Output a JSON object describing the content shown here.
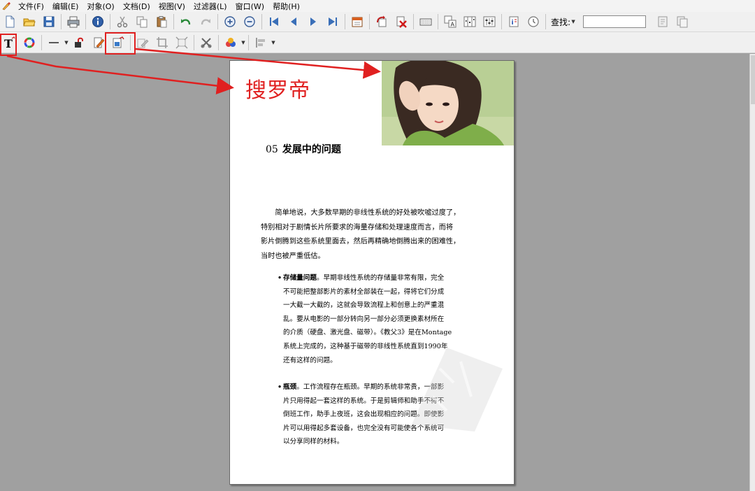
{
  "menubar": {
    "items": [
      "文件(F)",
      "编辑(E)",
      "对象(O)",
      "文档(D)",
      "视图(V)",
      "过滤器(L)",
      "窗口(W)",
      "帮助(H)"
    ]
  },
  "toolbar": {
    "find_label": "查找:",
    "find_value": ""
  },
  "annotation": {
    "label": "搜罗帝",
    "color": "#e02020"
  },
  "document": {
    "chapter_number": "05",
    "chapter_title": "发展中的问题",
    "intro_lines": [
      "简单地说，大多数早期的非线性系统的好处被吹嘘过度了，",
      "特别相对于剧情长片所要求的海量存储和处理速度而言，而将",
      "影片倒腾到这些系统里面去，然后再精确地倒腾出来的困难性，",
      "当时也被严重低估。"
    ],
    "bullets": [
      {
        "lead": "存储量问题",
        "lines": [
          "。早期非线性系统的存储量非常有限，完全",
          "不可能把整部影片的素材全部装在一起，得将它们分成",
          "一大截一大截的，这就会导致流程上和创意上的严重混",
          "乱。要从电影的一部分转向另一部分必须更换素材所在",
          "的介质（硬盘、激光盘、磁带）。《教父3》是在Montage",
          "系统上完成的，这种基于磁带的非线性系统直到1990年",
          "还有这样的问题。"
        ]
      },
      {
        "lead": "瓶颈",
        "lines": [
          "。工作流程存在瓶颈。早期的系统非常贵，一部影",
          "片只用得起一套这样的系统。于是剪辑师和助手不得不",
          "倒班工作，助手上夜班，这会出现相应的问题。即使影",
          "片可以用得起多套设备，也完全没有可能使各个系统可",
          "以分享同样的材料。"
        ]
      }
    ]
  }
}
